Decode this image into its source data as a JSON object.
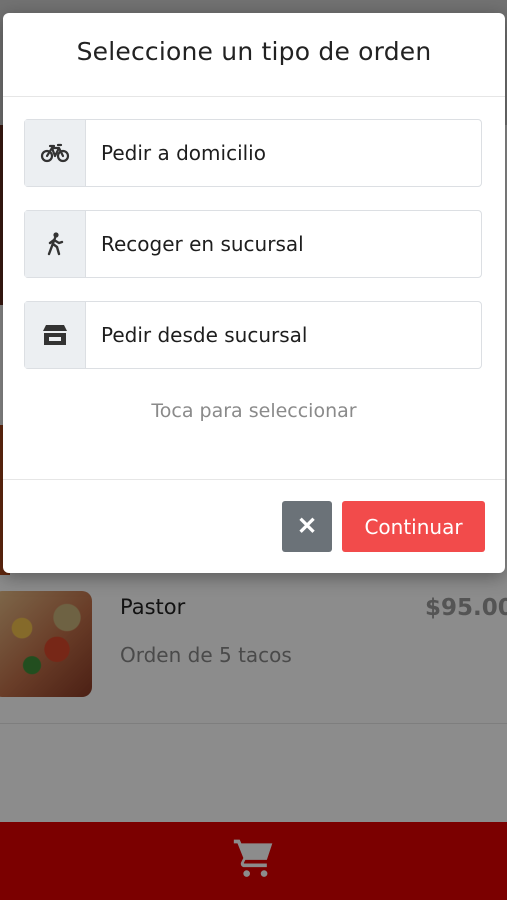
{
  "modal": {
    "title": "Seleccione un tipo de orden",
    "options": [
      {
        "label": "Pedir a domicilio",
        "icon": "bicycle-icon"
      },
      {
        "label": "Recoger en sucursal",
        "icon": "walking-person-icon"
      },
      {
        "label": "Pedir desde sucursal",
        "icon": "store-icon"
      }
    ],
    "hint": "Toca para seleccionar",
    "close_label": "✕",
    "continue_label": "Continuar"
  },
  "product": {
    "name": "Pastor",
    "description": "Orden de 5 tacos",
    "price": "$95.00"
  },
  "bottom_bar": {
    "icon": "cart-icon"
  },
  "colors": {
    "accent": "#f24b4b",
    "bottom_bar": "#e00000",
    "close_button": "#6b7278",
    "icon_box": "#eceff2"
  }
}
